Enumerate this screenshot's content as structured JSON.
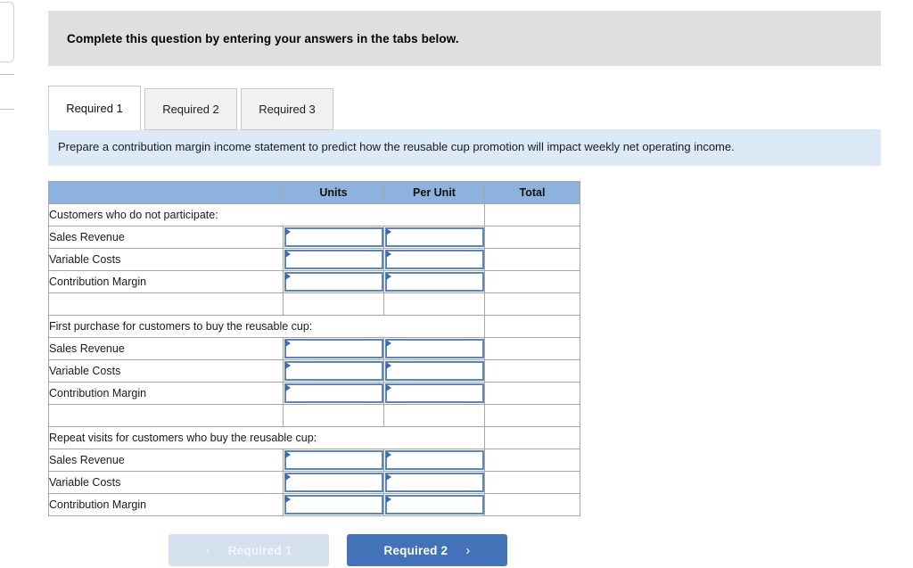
{
  "question_banner": {
    "text": "Complete this question by entering your answers in the tabs below."
  },
  "tabs": [
    {
      "label": "Required 1",
      "active": true
    },
    {
      "label": "Required 2",
      "active": false
    },
    {
      "label": "Required 3",
      "active": false
    }
  ],
  "requirement": {
    "description": "Prepare a contribution margin income statement to predict how the reusable cup promotion will impact weekly net operating income."
  },
  "table": {
    "headers": [
      "",
      "Units",
      "Per Unit",
      "Total"
    ],
    "rows": [
      {
        "type": "section",
        "label": "Customers who do not participate:"
      },
      {
        "type": "entry",
        "label": "Sales Revenue"
      },
      {
        "type": "entry",
        "label": "Variable Costs"
      },
      {
        "type": "entry",
        "label": "Contribution Margin"
      },
      {
        "type": "spacer",
        "label": ""
      },
      {
        "type": "section",
        "label": "First purchase for customers to buy the reusable cup:"
      },
      {
        "type": "entry",
        "label": "Sales Revenue"
      },
      {
        "type": "entry",
        "label": "Variable Costs"
      },
      {
        "type": "entry",
        "label": "Contribution Margin"
      },
      {
        "type": "spacer",
        "label": ""
      },
      {
        "type": "section",
        "label": "Repeat visits for customers who buy the reusable cup:"
      },
      {
        "type": "entry",
        "label": "Sales Revenue"
      },
      {
        "type": "entry",
        "label": "Variable Costs"
      },
      {
        "type": "entry",
        "label": "Contribution Margin"
      }
    ]
  },
  "navigation": {
    "prev_label": "Required 1",
    "prev_chevron": "chevron-left-icon",
    "prev_glyph": "‹",
    "next_label": "Required 2",
    "next_chevron": "chevron-right-icon",
    "next_glyph": "›"
  },
  "colors": {
    "banner_gray": "#dfdfdf",
    "requirement_blue": "#dce9f7",
    "table_header_blue": "#8cb2dd",
    "input_border_blue": "#5b85bf",
    "marker_blue": "#3d6ba8",
    "next_button_blue": "#4472b8",
    "prev_button_blue": "#d5e0ef"
  }
}
